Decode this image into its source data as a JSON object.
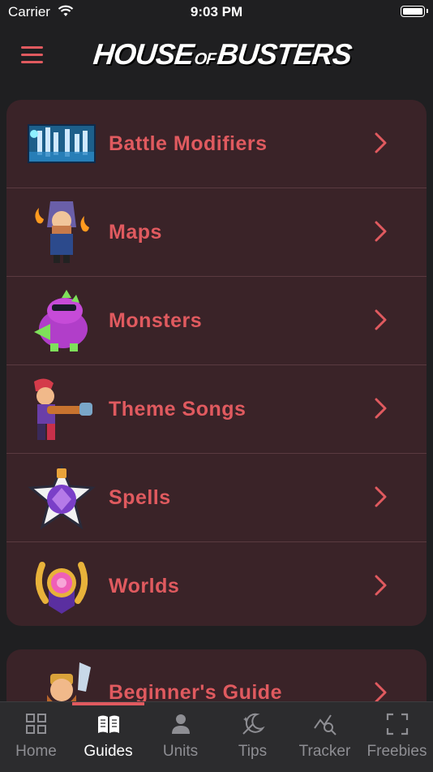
{
  "status_bar": {
    "carrier": "Carrier",
    "time": "9:03 PM"
  },
  "header": {
    "logo": {
      "part1": "HOUSE",
      "part2": "OF",
      "part3": "BUSTERS"
    }
  },
  "guides": [
    {
      "label": "Battle Modifiers",
      "icon": "battle-modifiers-thumbnail"
    },
    {
      "label": "Maps",
      "icon": "wizard-character-icon"
    },
    {
      "label": "Monsters",
      "icon": "dinosaur-monster-icon"
    },
    {
      "label": "Theme Songs",
      "icon": "gunner-character-icon"
    },
    {
      "label": "Spells",
      "icon": "star-bomb-icon"
    },
    {
      "label": "Worlds",
      "icon": "laurel-medal-icon"
    }
  ],
  "secondary": [
    {
      "label": "Beginner's Guide",
      "icon": "barbarian-character-icon"
    }
  ],
  "tabs": [
    {
      "label": "Home",
      "icon": "grid-icon"
    },
    {
      "label": "Guides",
      "icon": "book-icon"
    },
    {
      "label": "Units",
      "icon": "person-icon"
    },
    {
      "label": "Tips",
      "icon": "magic-wand-icon"
    },
    {
      "label": "Tracker",
      "icon": "chart-search-icon"
    },
    {
      "label": "Freebies",
      "icon": "viewfinder-icon"
    }
  ],
  "colors": {
    "accent": "#e05a5f",
    "card": "#3a2328",
    "background": "#1f1f21",
    "tabbar": "#2c2c2e"
  }
}
